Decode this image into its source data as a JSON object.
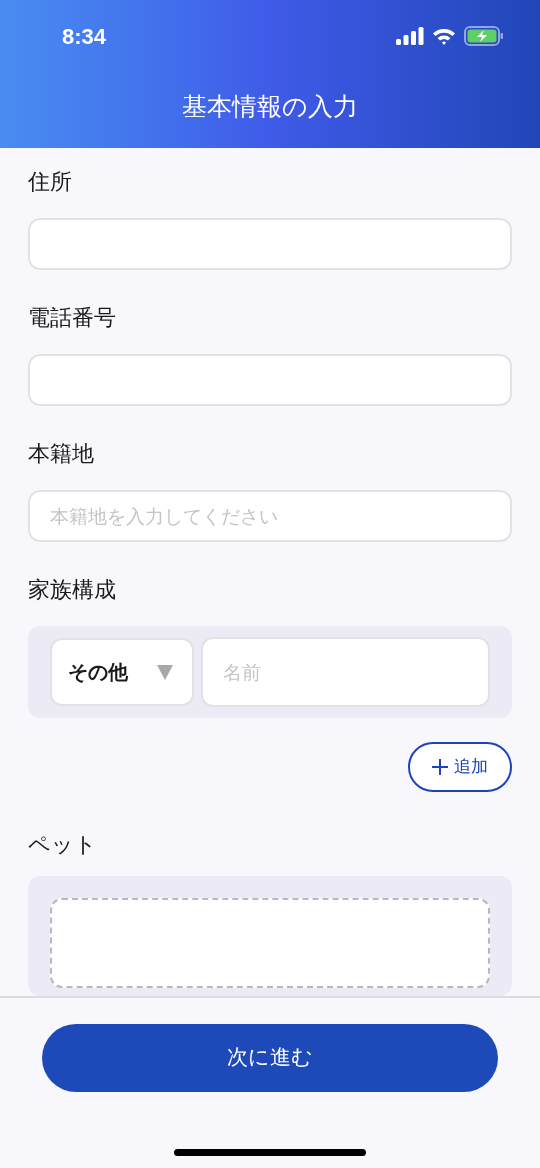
{
  "status_bar": {
    "time": "8:34"
  },
  "header": {
    "title": "基本情報の入力"
  },
  "fields": [
    {
      "label": "住所"
    },
    {
      "label": "電話番号"
    },
    {
      "label": "本籍地",
      "placeholder": "本籍地を入力してください"
    }
  ],
  "family": {
    "label": "家族構成",
    "relation": "その他",
    "name_placeholder": "名前",
    "add_button": "追加"
  },
  "pet": {
    "label": "ペット"
  },
  "next_button": "次に進む"
}
